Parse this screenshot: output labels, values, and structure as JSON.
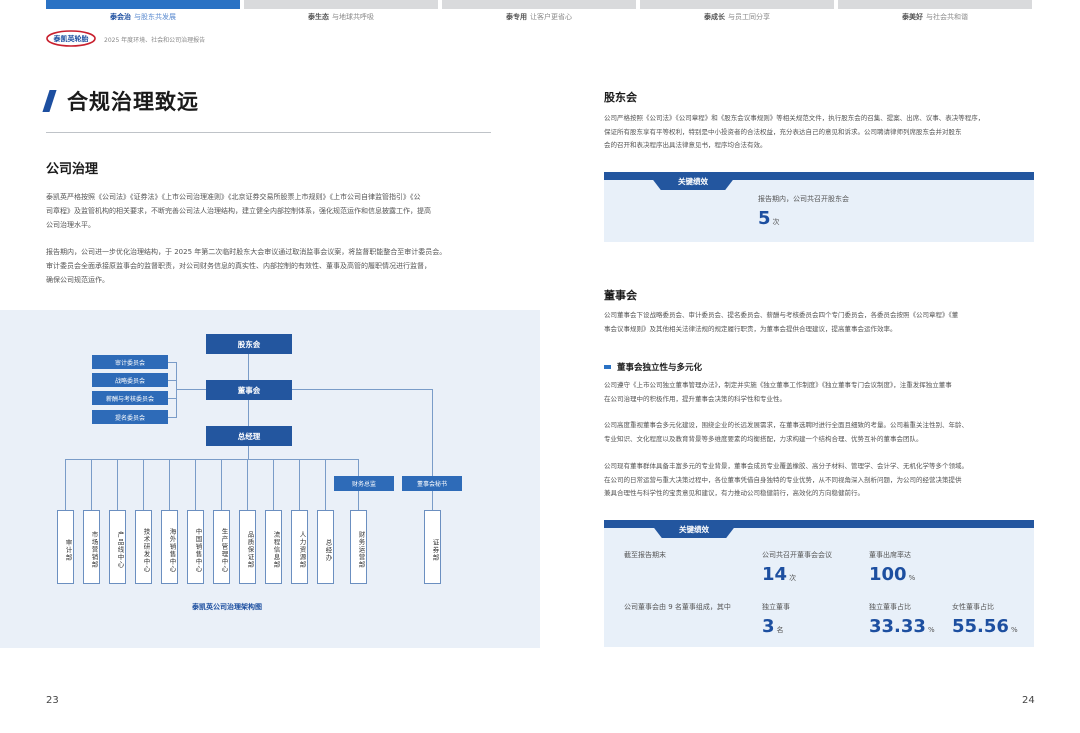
{
  "tabs": [
    {
      "bold": "泰会治",
      "rest": "与股东共发展"
    },
    {
      "bold": "泰生态",
      "rest": "与地球共呼吸"
    },
    {
      "bold": "泰专用",
      "rest": "让客户更省心"
    },
    {
      "bold": "泰成长",
      "rest": "与员工同分享"
    },
    {
      "bold": "泰美好",
      "rest": "与社会共和谐"
    }
  ],
  "header": {
    "logo_text": "泰凯英轮胎",
    "subtitle": "2025 年度环境、社会和公司治理报告"
  },
  "left": {
    "title": "合规治理致远",
    "section": "公司治理",
    "para1": [
      "泰凯英严格按照《公司法》《证券法》《上市公司治理准则》《北京证券交易所股票上市规则》《上市公司自律监管指引》《公",
      "司章程》及监管机构的相关要求，不断完善公司法人治理结构，建立健全内部控制体系，强化规范运作和信息披露工作，提高",
      "公司治理水平。"
    ],
    "para2": [
      "报告期内，公司进一步优化治理结构，于 2025 年第二次临时股东大会审议通过取消监事会议案，将监督职能整合至审计委员会。",
      "审计委员会全面承接原监事会的监督职责，对公司财务信息的真实性、内部控制的有效性、董事及高管的履职情况进行监督，",
      "确保公司规范运作。"
    ],
    "org": {
      "top": "股东会",
      "board": "董事会",
      "gm": "总经理",
      "committees": [
        "审计委员会",
        "战略委员会",
        "薪酬与考核委员会",
        "提名委员会"
      ],
      "cfo": "财务总监",
      "secretary": "董事会秘书",
      "depts": [
        "审计部",
        "市场营销部",
        "产品线中心",
        "技术研发中心",
        "海外销售中心",
        "中国销售中心",
        "生产管理中心",
        "品质保证部",
        "流程信息部",
        "人力资源部",
        "总经办",
        "财务运营部",
        "证券部"
      ],
      "caption": "泰凯英公司治理架构图"
    },
    "page_number": "23"
  },
  "right": {
    "s1": "股东会",
    "s1_para": [
      "公司严格按照《公司法》《公司章程》和《股东会议事规则》等相关规范文件，执行股东会的召集、提案、出席、议事、表决等程序，",
      "保证所有股东享有平等权利，特别是中小投资者的合法权益，充分表达自己的意见和诉求。公司聘请律师列席股东会并对股东",
      "会的召开和表决程序出具法律意见书，程序均合法有效。"
    ],
    "kpi_label": "关键绩效",
    "kpi1": {
      "label": "报告期内，公司共召开股东会",
      "value": "5",
      "unit": "次"
    },
    "s2": "董事会",
    "s2_para": [
      "公司董事会下设战略委员会、审计委员会、提名委员会、薪酬与考核委员会四个专门委员会，各委员会按照《公司章程》《董",
      "事会议事规则》及其他相关法律法规的规定履行职责，为董事会提供合理建议，提高董事会运作效率。"
    ],
    "sub": "董事会独立性与多元化",
    "p3": [
      "公司遵守《上市公司独立董事管理办法》，制定并实施《独立董事工作制度》《独立董事专门会议制度》，注重发挥独立董事",
      "在公司治理中的积极作用，提升董事会决策的科学性和专业性。"
    ],
    "p4": [
      "公司高度重视董事会多元化建设，围绕企业的长远发展需求，在董事选聘时进行全面且细致的考量。公司着重关注性别、年龄、",
      "专业知识、文化程度以及教育背景等多维度要素的均衡搭配，力求构建一个结构合理、优势互补的董事会团队。"
    ],
    "p5": [
      "公司现有董事群体具备丰富多元的专业背景，董事会成员专业覆盖橡胶、高分子材料、管理学、会计学、无机化学等多个领域。",
      "在公司的日常运营与重大决策过程中，各位董事凭借自身独特的专业优势，从不同视角深入剖析问题，为公司的经营决策提供",
      "兼具合理性与科学性的宝贵意见和建议，有力推动公司稳健前行，高效化的方向稳健前行。"
    ],
    "kpi2": {
      "left1": "截至报告期末",
      "left2": "公司董事会由 9 名董事组成，其中",
      "meet_label": "公司共召开董事会会议",
      "meet_value": "14",
      "meet_unit": "次",
      "att_label": "董事出席率达",
      "att_value": "100",
      "att_unit": "%",
      "ind_label": "独立董事",
      "ind_value": "3",
      "ind_unit": "名",
      "indr_label": "独立董事占比",
      "indr_value": "33.33",
      "indr_unit": "%",
      "fem_label": "女性董事占比",
      "fem_value": "55.56",
      "fem_unit": "%"
    },
    "page_number": "24"
  },
  "colors": {
    "brand": "#1d4fa0",
    "accent": "#2a72c4",
    "panel": "#e8f0f9"
  }
}
